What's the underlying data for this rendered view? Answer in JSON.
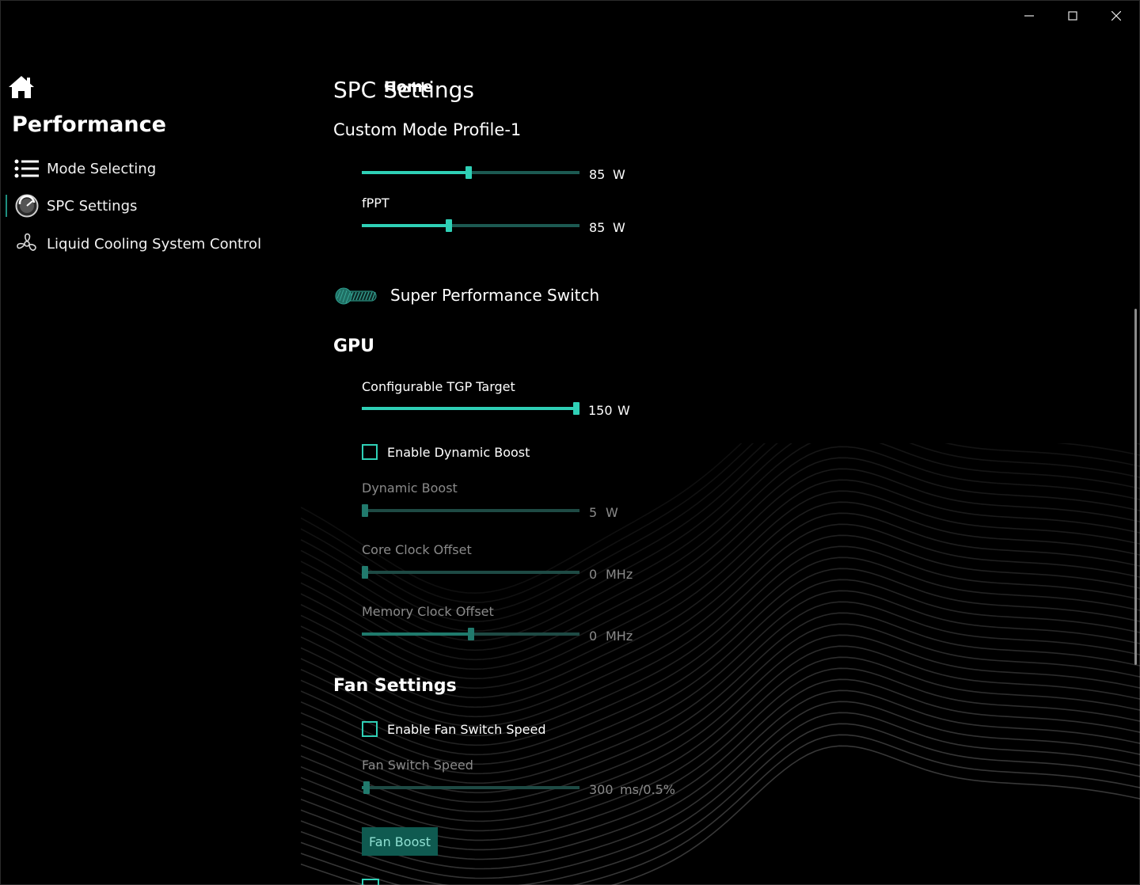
{
  "sidebar": {
    "home_label": "Home",
    "section_title": "Performance",
    "items": [
      {
        "label": "Mode Selecting",
        "icon": "list-icon"
      },
      {
        "label": "SPC Settings",
        "icon": "gauge-icon",
        "active": true
      },
      {
        "label": "Liquid Cooling System Control",
        "icon": "fan-icon"
      }
    ]
  },
  "main": {
    "title": "SPC Settings",
    "profile": "Custom Mode Profile-1",
    "cpu": {
      "spl": {
        "value": "85",
        "unit": "W",
        "fraction": 0.49
      },
      "fppt": {
        "label": "fPPT",
        "value": "85",
        "unit": "W",
        "fraction": 0.4
      }
    },
    "super_switch_label": "Super Performance Switch",
    "gpu": {
      "title": "GPU",
      "tgp": {
        "label": "Configurable TGP Target",
        "value": "150",
        "unit": "W",
        "fraction": 1.0
      },
      "dynamic_boost_enable": "Enable Dynamic Boost",
      "dynamic_boost": {
        "label": "Dynamic Boost",
        "value": "5",
        "unit": "W",
        "fraction": 0.01
      },
      "core_clock": {
        "label": "Core Clock Offset",
        "value": "0",
        "unit": "MHz",
        "fraction": 0.01
      },
      "memory_clock": {
        "label": "Memory Clock Offset",
        "value": "0",
        "unit": "MHz",
        "fraction": 0.5
      }
    },
    "fan": {
      "title": "Fan Settings",
      "switch_enable": "Enable Fan Switch Speed",
      "switch_speed": {
        "label": "Fan Switch Speed",
        "value": "300",
        "unit": "ms/0.5%",
        "fraction": 0.02
      },
      "boost_label": "Fan Boost"
    }
  },
  "colors": {
    "accent": "#2fd0b6",
    "accent_dim": "#1c5a52",
    "background": "#000000"
  }
}
